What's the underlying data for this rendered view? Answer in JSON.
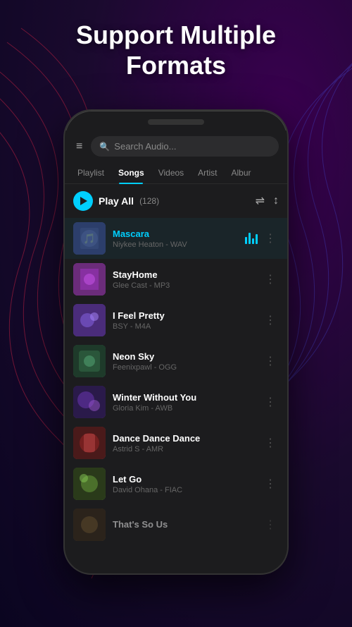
{
  "header": {
    "title_line1": "Support Multiple",
    "title_line2": "Formats"
  },
  "search": {
    "placeholder": "Search Audio..."
  },
  "tabs": [
    {
      "id": "playlist",
      "label": "Playlist",
      "active": false
    },
    {
      "id": "songs",
      "label": "Songs",
      "active": true
    },
    {
      "id": "videos",
      "label": "Videos",
      "active": false
    },
    {
      "id": "artist",
      "label": "Artist",
      "active": false
    },
    {
      "id": "album",
      "label": "Albur",
      "active": false
    }
  ],
  "playAll": {
    "label": "Play All",
    "count": "(128)"
  },
  "songs": [
    {
      "id": 1,
      "title": "Mascara",
      "meta": "Niykee Heaton - WAV",
      "active": true,
      "thumb_class": "thumb-1",
      "emoji": "🎵"
    },
    {
      "id": 2,
      "title": "StayHome",
      "meta": "Glee Cast - MP3",
      "active": false,
      "thumb_class": "thumb-2",
      "emoji": "🎵"
    },
    {
      "id": 3,
      "title": "I Feel Pretty",
      "meta": "BSY - M4A",
      "active": false,
      "thumb_class": "thumb-3",
      "emoji": "🎵"
    },
    {
      "id": 4,
      "title": "Neon Sky",
      "meta": "Feenixpawl - OGG",
      "active": false,
      "thumb_class": "thumb-4",
      "emoji": "🎵"
    },
    {
      "id": 5,
      "title": "Winter Without You",
      "meta": "Gloria Kim - AWB",
      "active": false,
      "thumb_class": "thumb-5",
      "emoji": "🎵"
    },
    {
      "id": 6,
      "title": "Dance Dance Dance",
      "meta": "Astrid S - AMR",
      "active": false,
      "thumb_class": "thumb-6",
      "emoji": "🎵"
    },
    {
      "id": 7,
      "title": "Let Go",
      "meta": "David Ohana - FIAC",
      "active": false,
      "thumb_class": "thumb-7",
      "emoji": "🎵"
    },
    {
      "id": 8,
      "title": "That's So Us",
      "meta": "",
      "active": false,
      "thumb_class": "thumb-8",
      "emoji": "🎵"
    }
  ],
  "icons": {
    "hamburger": "≡",
    "search": "🔍",
    "shuffle": "⇌",
    "sort": "↕",
    "more": "⋮"
  }
}
